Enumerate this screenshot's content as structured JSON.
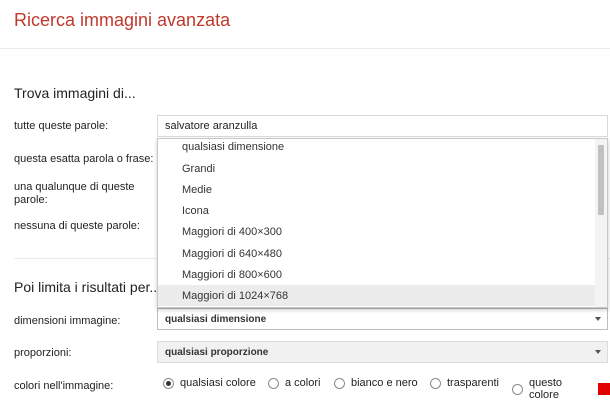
{
  "header": {
    "title": "Ricerca immagini avanzata"
  },
  "find_section": {
    "title": "Trova immagini di...",
    "all_words_label": "tutte queste parole:",
    "all_words_value": "salvatore aranzulla",
    "exact_phrase_label": "questa esatta parola o frase:",
    "any_words_label": "una qualunque di queste parole:",
    "none_words_label": "nessuna di queste parole:"
  },
  "limit_section": {
    "title": "Poi limita i risultati per...",
    "size_label": "dimensioni immagine:",
    "size_value": "qualsiasi dimensione",
    "aspect_label": "proporzioni:",
    "aspect_value": "qualsiasi proporzione",
    "colors_label": "colori nell'immagine:"
  },
  "size_dropdown": {
    "options": [
      "qualsiasi dimensione",
      "Grandi",
      "Medie",
      "Icona",
      "Maggiori di 400×300",
      "Maggiori di 640×480",
      "Maggiori di 800×600",
      "Maggiori di 1024×768"
    ],
    "highlighted_index": 7
  },
  "color_options": {
    "any": "qualsiasi colore",
    "full": "a colori",
    "bw": "bianco e nero",
    "transparent": "trasparenti",
    "this": "questo colore",
    "selected": "any",
    "swatch_color": "#e00000"
  }
}
